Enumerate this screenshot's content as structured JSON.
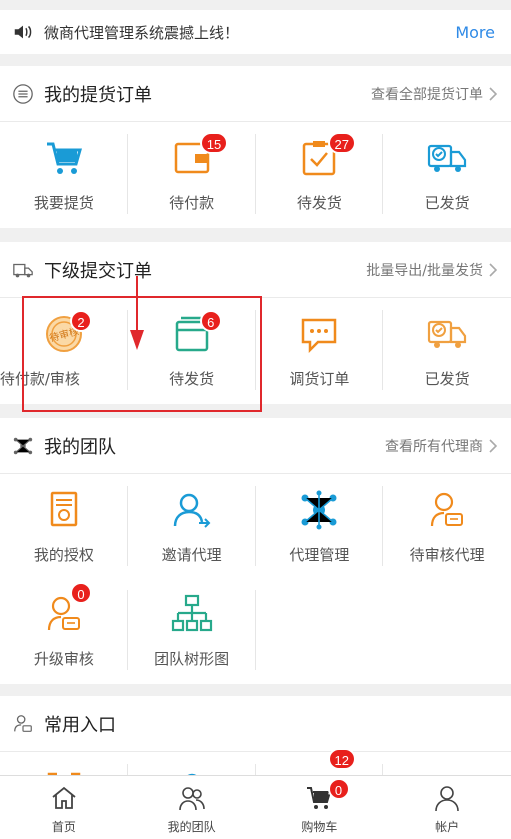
{
  "notice": {
    "text": "微商代理管理系统震撼上线！",
    "more": "More"
  },
  "pickup": {
    "title": "我的提货订单",
    "link": "查看全部提货订单",
    "items": [
      {
        "label": "我要提货",
        "badge": null
      },
      {
        "label": "待付款",
        "badge": "15"
      },
      {
        "label": "待发货",
        "badge": "27"
      },
      {
        "label": "已发货",
        "badge": null
      }
    ]
  },
  "sub": {
    "title": "下级提交订单",
    "link": "批量导出/批量发货",
    "items": [
      {
        "label": "待付款/审核",
        "badge": "2",
        "stamp": "待审核"
      },
      {
        "label": "待发货",
        "badge": "6"
      },
      {
        "label": "调货订单",
        "badge": null
      },
      {
        "label": "已发货",
        "badge": null
      }
    ]
  },
  "team": {
    "title": "我的团队",
    "link": "查看所有代理商",
    "items": [
      {
        "label": "我的授权"
      },
      {
        "label": "邀请代理"
      },
      {
        "label": "代理管理"
      },
      {
        "label": "待审核代理"
      },
      {
        "label": "升级审核",
        "badge": "0"
      },
      {
        "label": "团队树形图"
      }
    ]
  },
  "common": {
    "title": "常用入口",
    "partial_badge": "12"
  },
  "tabbar": {
    "items": [
      {
        "label": "首页"
      },
      {
        "label": "我的团队"
      },
      {
        "label": "购物车",
        "badge": "0"
      },
      {
        "label": "帐户"
      }
    ]
  },
  "colors": {
    "blue": "#1a9bd6",
    "orange": "#f08a1c",
    "green": "#27a98b",
    "red": "#e8201c",
    "link": "#2f8ae6"
  }
}
